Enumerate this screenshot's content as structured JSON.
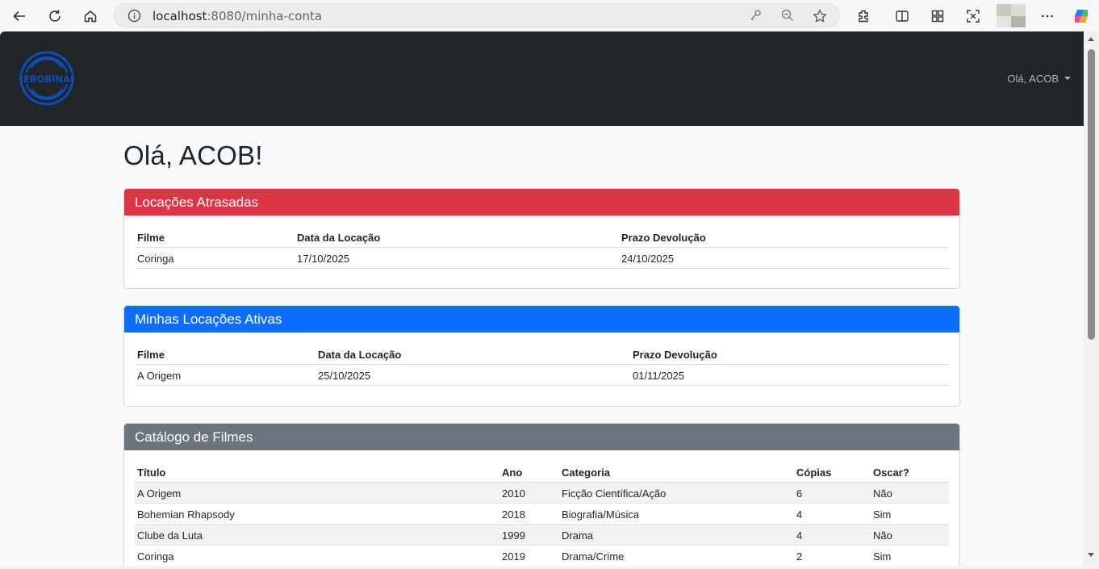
{
  "browser": {
    "url_host": "localhost",
    "url_rest": ":8080/minha-conta"
  },
  "navbar": {
    "logo_text": "REBOBINAR",
    "user_menu_label": "Olá, ACOB"
  },
  "page": {
    "heading": "Olá, ACOB!"
  },
  "colors": {
    "danger": "#dc3545",
    "primary": "#0d6efd",
    "secondary": "#6c757d",
    "navbar": "#212529"
  },
  "overdue": {
    "title": "Locações Atrasadas",
    "columns": [
      "Filme",
      "Data da Locação",
      "Prazo Devolução"
    ],
    "rows": [
      [
        "Coringa",
        "17/10/2025",
        "24/10/2025"
      ]
    ]
  },
  "active": {
    "title": "Minhas Locações Ativas",
    "columns": [
      "Filme",
      "Data da Locação",
      "Prazo Devolução"
    ],
    "rows": [
      [
        "A Origem",
        "25/10/2025",
        "01/11/2025"
      ]
    ]
  },
  "catalog": {
    "title": "Catálogo de Filmes",
    "columns": [
      "Título",
      "Ano",
      "Categoria",
      "Cópias",
      "Oscar?"
    ],
    "rows": [
      [
        "A Origem",
        "2010",
        "Ficção Científica/Ação",
        "6",
        "Não"
      ],
      [
        "Bohemian Rhapsody",
        "2018",
        "Biografia/Música",
        "4",
        "Sim"
      ],
      [
        "Clube da Luta",
        "1999",
        "Drama",
        "4",
        "Não"
      ],
      [
        "Coringa",
        "2019",
        "Drama/Crime",
        "2",
        "Sim"
      ]
    ]
  }
}
